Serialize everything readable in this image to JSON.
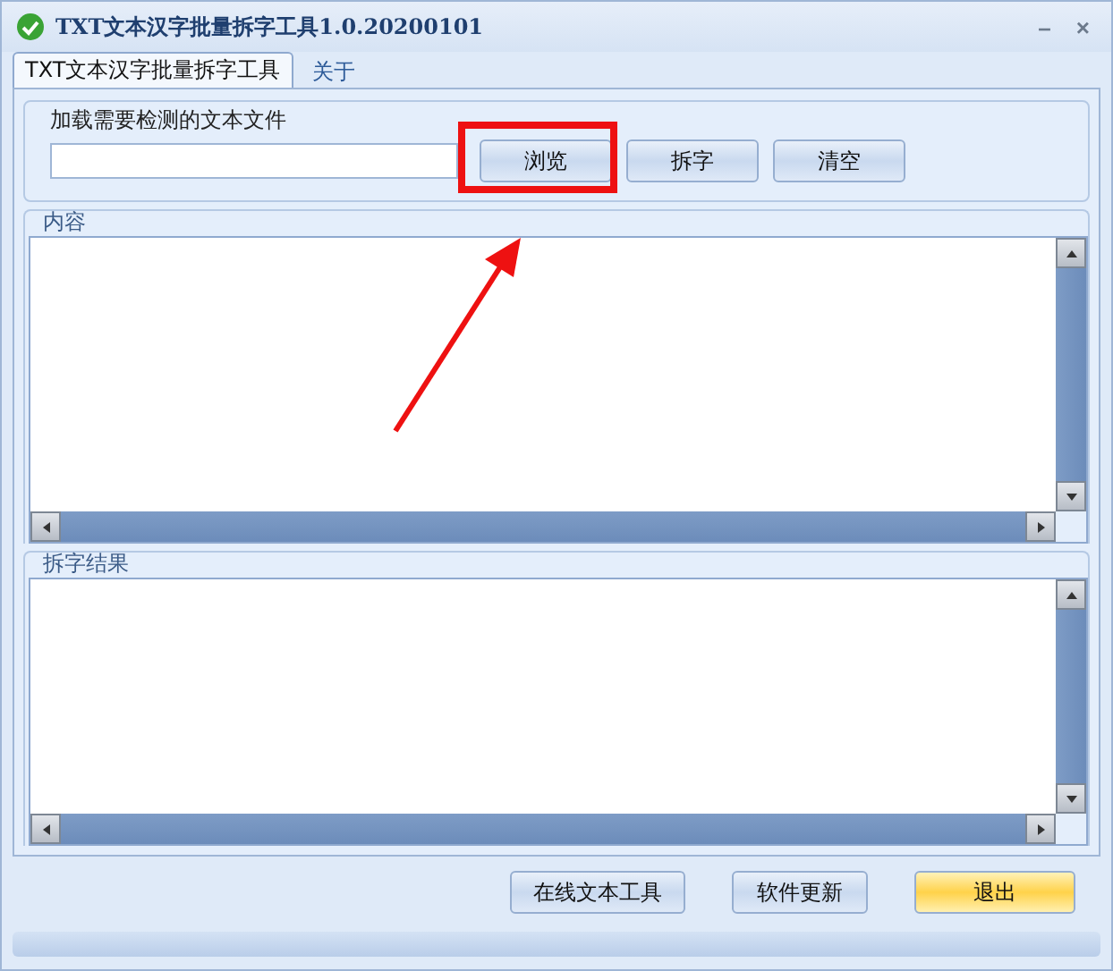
{
  "window": {
    "title": "TXT文本汉字批量拆字工具1.0.20200101",
    "controls": [
      "–",
      "×"
    ]
  },
  "tabs": [
    {
      "label": "TXT文本汉字批量拆字工具",
      "selected": true
    },
    {
      "label": "关于",
      "selected": false
    }
  ],
  "file_group": {
    "label": "加载需要检测的文本文件",
    "buttons": [
      {
        "label": "浏览",
        "highlighted": true
      },
      {
        "label": "拆字",
        "highlighted": false
      },
      {
        "label": "清空",
        "highlighted": false
      }
    ]
  },
  "content": {
    "label": "内容"
  },
  "result": {
    "label": "拆字结果"
  },
  "footer_buttons": [
    {
      "label": "在线文本工具",
      "hovered": false
    },
    {
      "label": "软件更新",
      "hovered": false
    },
    {
      "label": "退出",
      "hovered": true
    }
  ]
}
